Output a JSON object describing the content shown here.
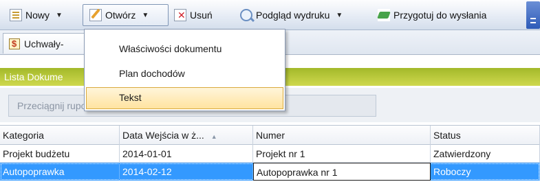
{
  "toolbar": {
    "new_label": "Nowy",
    "open_label": "Otwórz",
    "delete_label": "Usuń",
    "print_preview_label": "Podgląd wydruku",
    "prepare_send_label": "Przygotuj do wysłania",
    "dropdown_glyph": "▼"
  },
  "tabs": [
    {
      "label": "Uchwały-"
    }
  ],
  "panel": {
    "title": "Lista Dokume",
    "group_hint": "Przeciągnij                                        rupować dane."
  },
  "grid": {
    "columns": [
      "Kategoria",
      "Data Wejścia w ż...",
      "Numer",
      "Status"
    ],
    "sort_glyph": "▲",
    "rows": [
      [
        "Projekt budżetu",
        "2014-01-01",
        "Projekt nr 1",
        "Zatwierdzony"
      ],
      [
        "Autopoprawka",
        "2014-02-12",
        "Autopoprawka nr 1",
        "Roboczy"
      ]
    ],
    "selected_row": 1
  },
  "open_menu": {
    "items": [
      "Właściwości dokumentu",
      "Plan dochodów",
      "Tekst"
    ],
    "highlighted": 2
  },
  "colors": {
    "header_green": "#a3b92a",
    "selection_blue": "#3399ff",
    "menu_highlight": "#ffe3a0"
  }
}
